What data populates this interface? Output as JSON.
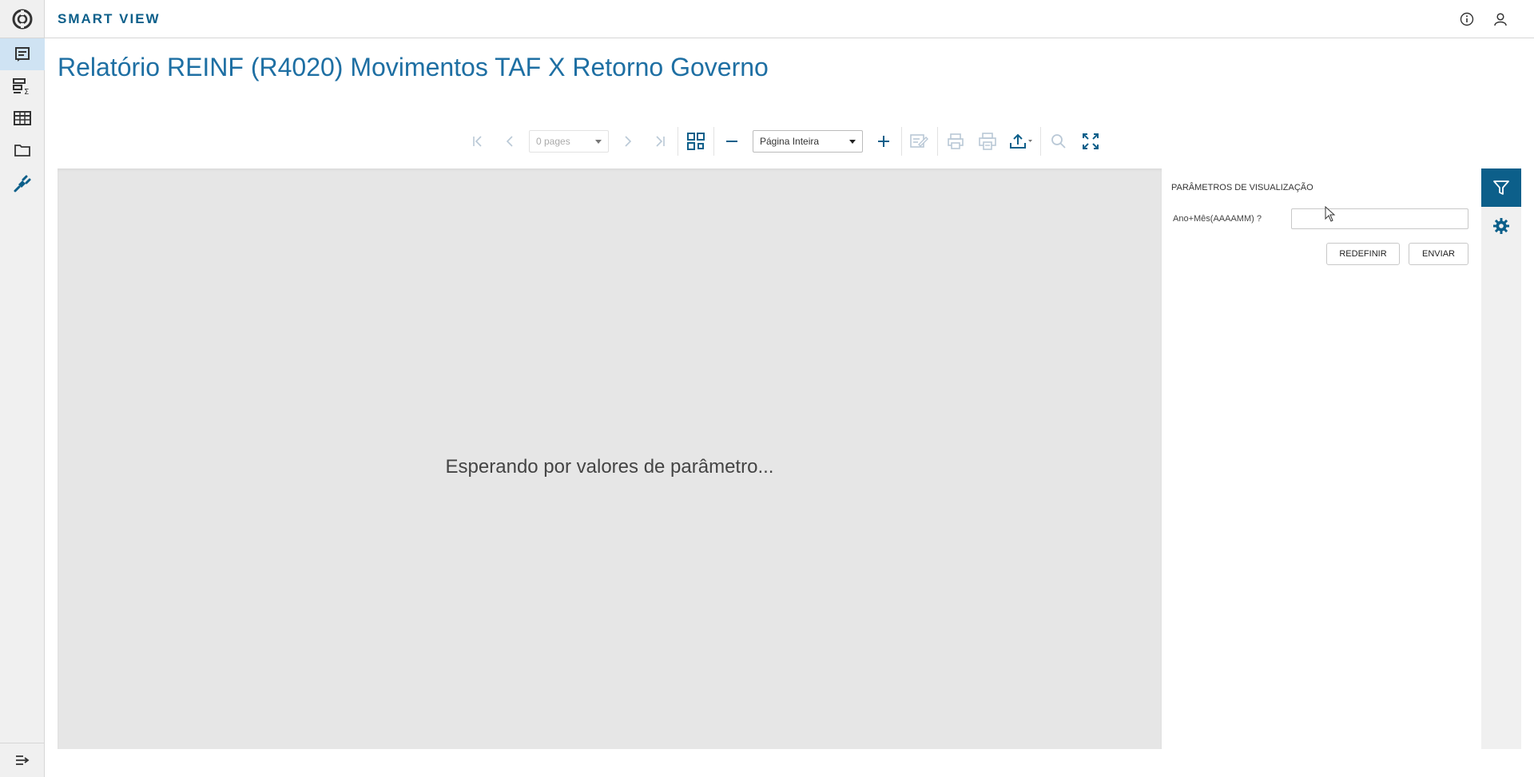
{
  "header": {
    "brand": "SMART VIEW",
    "info_icon": "info-circle-icon",
    "user_icon": "user-icon"
  },
  "sidebar": {
    "logo_icon": "app-logo-icon",
    "items": [
      {
        "icon": "report-icon",
        "active": true
      },
      {
        "icon": "analysis-sigma-icon",
        "active": false
      },
      {
        "icon": "table-grid-icon",
        "active": false
      },
      {
        "icon": "folder-icon",
        "active": false
      },
      {
        "icon": "plug-icon",
        "active": false
      }
    ],
    "collapse_icon": "expand-menu-icon"
  },
  "page": {
    "title": "Relatório REINF (R4020) Movimentos TAF X Retorno Governo"
  },
  "toolbar": {
    "pages_value": "0 pages",
    "zoom_value": "Página Inteira"
  },
  "viewer": {
    "message": "Esperando por valores de parâmetro..."
  },
  "params": {
    "title": "PARÂMETROS DE VISUALIZAÇÃO",
    "field_label": "Ano+Mês(AAAAMM) ?",
    "field_value": "",
    "reset_label": "REDEFINIR",
    "submit_label": "ENVIAR"
  },
  "colors": {
    "brand": "#0c5f8a",
    "title": "#1e6fa3",
    "active_rail": "#cfe3f3",
    "viewer_bg": "#e6e6e6"
  }
}
